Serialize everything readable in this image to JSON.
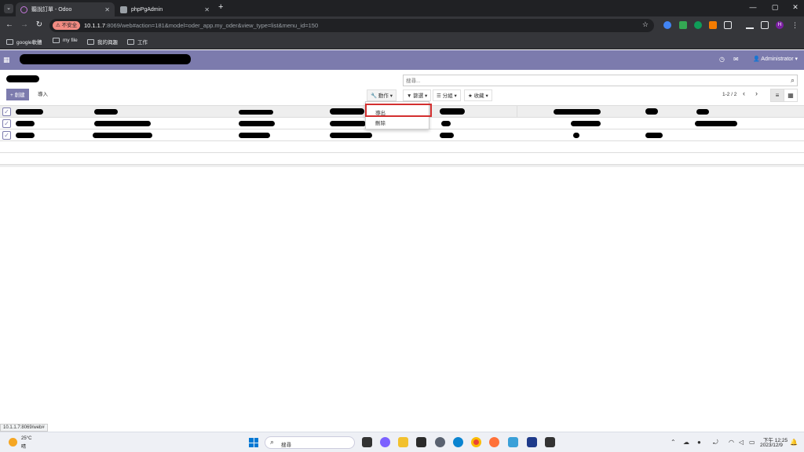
{
  "browser": {
    "tabs": [
      {
        "label": "聽說訂單 - Odoo",
        "active": true
      },
      {
        "label": "phpPgAdmin",
        "active": false
      }
    ],
    "new_tab": "+",
    "window_controls": [
      "—",
      "▢",
      "✕"
    ],
    "not_secure": "不安全",
    "url_host": "10.1.1.7",
    "url_path": ":8069/web#action=181&model=oder_app.my_oder&view_type=list&menu_id=150",
    "profile_initial": "H",
    "bookmarks": [
      "google軟體",
      "my file",
      "我的興趣",
      "工作"
    ]
  },
  "odoo": {
    "user": "Administrator",
    "search_placeholder": "搜尋...",
    "buttons": {
      "create": "+ 創建",
      "import": "導入"
    },
    "dropdowns": {
      "action": "動作",
      "filter": "篩選",
      "group": "分組",
      "favorite": "收藏"
    },
    "pager": "1-2 / 2",
    "action_menu": {
      "export": "導出",
      "delete": "刪除"
    },
    "accent": "#7c7bad"
  },
  "status_tip": "10.1.1.7:8069/web#",
  "taskbar": {
    "weather_temp": "25°C",
    "weather_cond": "晴",
    "search_label": "搜尋",
    "time": "下午 12:25",
    "date": "2023/12/9"
  }
}
